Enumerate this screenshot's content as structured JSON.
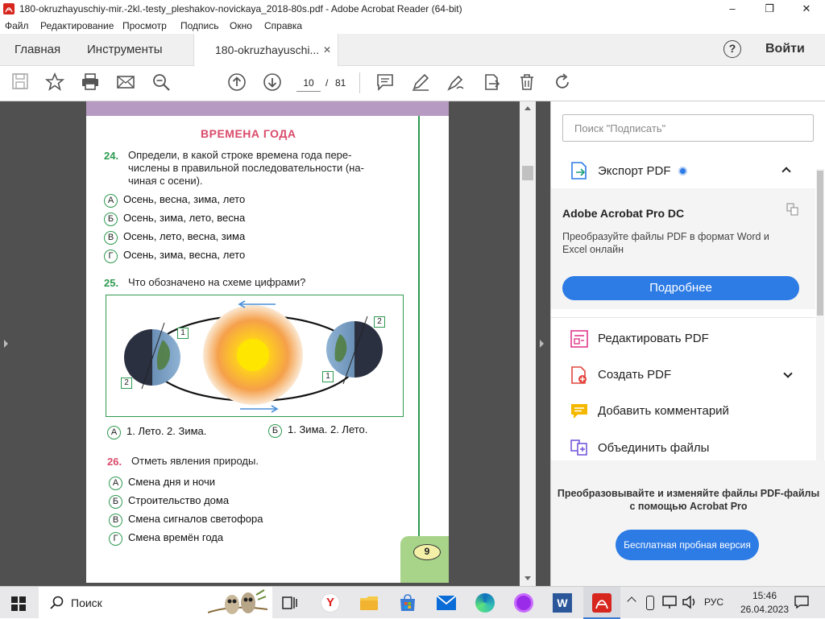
{
  "window": {
    "title": "180-okruzhayuschiy-mir.-2kl.-testy_pleshakov-novickaya_2018-80s.pdf - Adobe Acrobat Reader (64-bit)",
    "minimize": "–",
    "maximize": "❐",
    "close": "✕"
  },
  "menu": [
    "Файл",
    "Редактирование",
    "Просмотр",
    "Подпись",
    "Окно",
    "Справка"
  ],
  "tabs": {
    "home": "Главная",
    "tools": "Инструменты",
    "document": "180-okruzhayuschi...",
    "close": "✕",
    "help": "?",
    "signin": "Войти"
  },
  "toolbar": {
    "page_current": "10",
    "page_sep": "/",
    "page_total": "81"
  },
  "page": {
    "heading": "ВРЕМЕНА ГОДА",
    "q24": {
      "number": "24.",
      "text_l1": "Определи, в какой строке времена года пере-",
      "text_l2": "числены в правильной последовательности (на-",
      "text_l3": "чиная с осени).",
      "options": [
        {
          "letter": "А",
          "text": "Осень, весна, зима, лето"
        },
        {
          "letter": "Б",
          "text": "Осень, зима, лето, весна"
        },
        {
          "letter": "В",
          "text": "Осень, лето, весна, зима"
        },
        {
          "letter": "Г",
          "text": "Осень, зима, весна, лето"
        }
      ]
    },
    "q25": {
      "number": "25.",
      "text": "Что обозначено на схеме цифрами?",
      "labels": {
        "left_top": "1",
        "left_bottom": "2",
        "right_top": "2",
        "right_bottom": "1"
      },
      "answer_a_letter": "А",
      "answer_a": "1. Лето. 2. Зима.",
      "answer_b_letter": "Б",
      "answer_b": "1. Зима. 2. Лето."
    },
    "q26": {
      "number": "26.",
      "text": "Отметь явления природы.",
      "options": [
        {
          "letter": "А",
          "text": "Смена дня и ночи"
        },
        {
          "letter": "Б",
          "text": "Строительство дома"
        },
        {
          "letter": "В",
          "text": "Смена сигналов светофора"
        },
        {
          "letter": "Г",
          "text": "Смена времён года"
        }
      ]
    },
    "page_number": "9"
  },
  "right_pane": {
    "search_placeholder": "Поиск \"Подписать\"",
    "export_title": "Экспорт PDF",
    "promo_title": "Adobe Acrobat Pro DC",
    "promo_text_l1": "Преобразуйте файлы PDF в формат Word и",
    "promo_text_l2": "Excel онлайн",
    "promo_button": "Подробнее",
    "items": [
      {
        "label": "Редактировать PDF"
      },
      {
        "label": "Создать PDF"
      },
      {
        "label": "Добавить комментарий"
      },
      {
        "label": "Объединить файлы"
      }
    ],
    "footer_l1": "Преобразовывайте и изменяйте файлы PDF-файлы",
    "footer_l2": "с помощью Acrobat Pro",
    "trial_button": "Бесплатная пробная версия"
  },
  "taskbar": {
    "search": "Поиск",
    "lang": "РУС",
    "time": "15:46",
    "date": "26.04.2023"
  },
  "colors": {
    "accent_blue": "#2d7be5",
    "heading_red": "#d94b6a",
    "green": "#2e9a50",
    "acrobat_red": "#d7261e"
  }
}
